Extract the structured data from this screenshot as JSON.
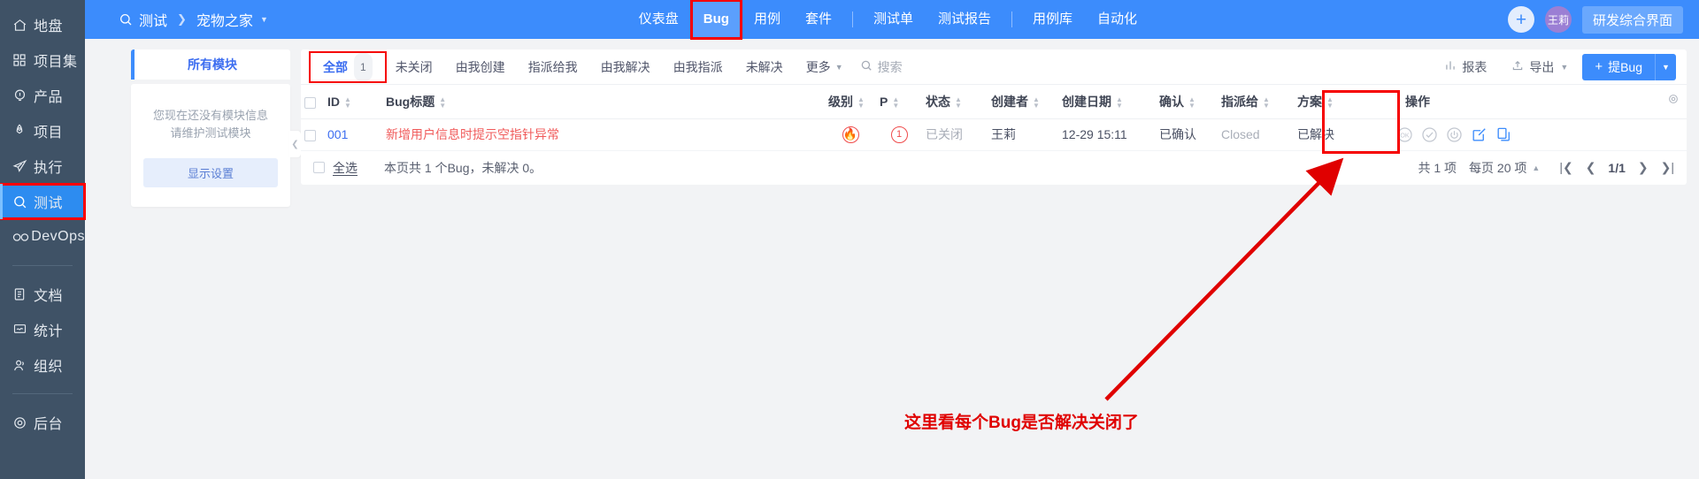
{
  "sidebar": {
    "items": [
      {
        "label": "地盘",
        "icon": "home-icon",
        "active": false
      },
      {
        "label": "项目集",
        "icon": "grid-icon",
        "active": false
      },
      {
        "label": "产品",
        "icon": "bulb-icon",
        "active": false
      },
      {
        "label": "项目",
        "icon": "rocket-icon",
        "active": false
      },
      {
        "label": "执行",
        "icon": "plane-icon",
        "active": false
      },
      {
        "label": "测试",
        "icon": "search-icon",
        "active": true
      },
      {
        "label": "DevOps",
        "icon": "infinity-icon",
        "active": false
      },
      {
        "label": "文档",
        "icon": "doc-icon",
        "active": false
      },
      {
        "label": "统计",
        "icon": "monitor-icon",
        "active": false
      },
      {
        "label": "组织",
        "icon": "people-icon",
        "active": false
      },
      {
        "label": "后台",
        "icon": "gear-icon",
        "active": false
      }
    ]
  },
  "topbar": {
    "breadcrumb": {
      "root": "测试",
      "separator": "❯",
      "current": "宠物之家"
    },
    "nav": [
      {
        "label": "仪表盘",
        "current": false,
        "divider_after": false
      },
      {
        "label": "Bug",
        "current": true,
        "divider_after": false
      },
      {
        "label": "用例",
        "current": false,
        "divider_after": false
      },
      {
        "label": "套件",
        "current": false,
        "divider_after": true
      },
      {
        "label": "测试单",
        "current": false,
        "divider_after": false
      },
      {
        "label": "测试报告",
        "current": false,
        "divider_after": true
      },
      {
        "label": "用例库",
        "current": false,
        "divider_after": false
      },
      {
        "label": "自动化",
        "current": false,
        "divider_after": false
      }
    ],
    "add_button": "+",
    "avatar_name": "王莉",
    "ui_switch_label": "研发综合界面"
  },
  "module_panel": {
    "tab_label": "所有模块",
    "empty_line1": "您现在还没有模块信息",
    "empty_line2": "请维护测试模块",
    "settings_button": "显示设置",
    "collapse_icon": "chevron-left-icon"
  },
  "filterbar": {
    "tabs": [
      {
        "label": "全部",
        "count": "1",
        "active": true
      },
      {
        "label": "未关闭",
        "count": "",
        "active": false
      },
      {
        "label": "由我创建",
        "count": "",
        "active": false
      },
      {
        "label": "指派给我",
        "count": "",
        "active": false
      },
      {
        "label": "由我解决",
        "count": "",
        "active": false
      },
      {
        "label": "由我指派",
        "count": "",
        "active": false
      },
      {
        "label": "未解决",
        "count": "",
        "active": false
      },
      {
        "label": "更多",
        "count": "",
        "active": false,
        "caret": true
      }
    ],
    "search_placeholder": "搜索",
    "report_label": "报表",
    "export_label": "导出",
    "submit_label": "提Bug"
  },
  "table": {
    "columns": [
      {
        "key": "checkbox",
        "label": "",
        "sortable": false
      },
      {
        "key": "id",
        "label": "ID",
        "sortable": true
      },
      {
        "key": "title",
        "label": "Bug标题",
        "sortable": true
      },
      {
        "key": "severity",
        "label": "级别",
        "sortable": true
      },
      {
        "key": "priority",
        "label": "P",
        "sortable": true
      },
      {
        "key": "status",
        "label": "状态",
        "sortable": true
      },
      {
        "key": "creator",
        "label": "创建者",
        "sortable": true
      },
      {
        "key": "created",
        "label": "创建日期",
        "sortable": true
      },
      {
        "key": "confirm",
        "label": "确认",
        "sortable": true
      },
      {
        "key": "assignee",
        "label": "指派给",
        "sortable": true
      },
      {
        "key": "solution",
        "label": "方案",
        "sortable": true
      },
      {
        "key": "actions",
        "label": "操作",
        "sortable": false
      }
    ],
    "settings_icon": "gear-icon",
    "rows": [
      {
        "id": "001",
        "title": "新增用户信息时提示空指针异常",
        "severity": "1",
        "priority": "1",
        "status": "已关闭",
        "creator": "王莉",
        "created": "12-29 15:11",
        "confirm": "已确认",
        "assignee": "Closed",
        "solution": "已解决",
        "actions": [
          "ok-icon",
          "check-circle-icon",
          "power-icon",
          "edit-icon",
          "copy-icon"
        ]
      }
    ]
  },
  "footer": {
    "select_all": "全选",
    "summary": "本页共 1 个Bug，未解决 0。",
    "total": "共 1 项",
    "page_size": "每页 20 项",
    "page_indicator": "1/1",
    "nav_first": "|❮",
    "nav_prev": "❮",
    "nav_next": "❯",
    "nav_last": "❯|"
  },
  "annotation": {
    "text": "这里看每个Bug是否解决关闭了",
    "color": "#e00000"
  }
}
